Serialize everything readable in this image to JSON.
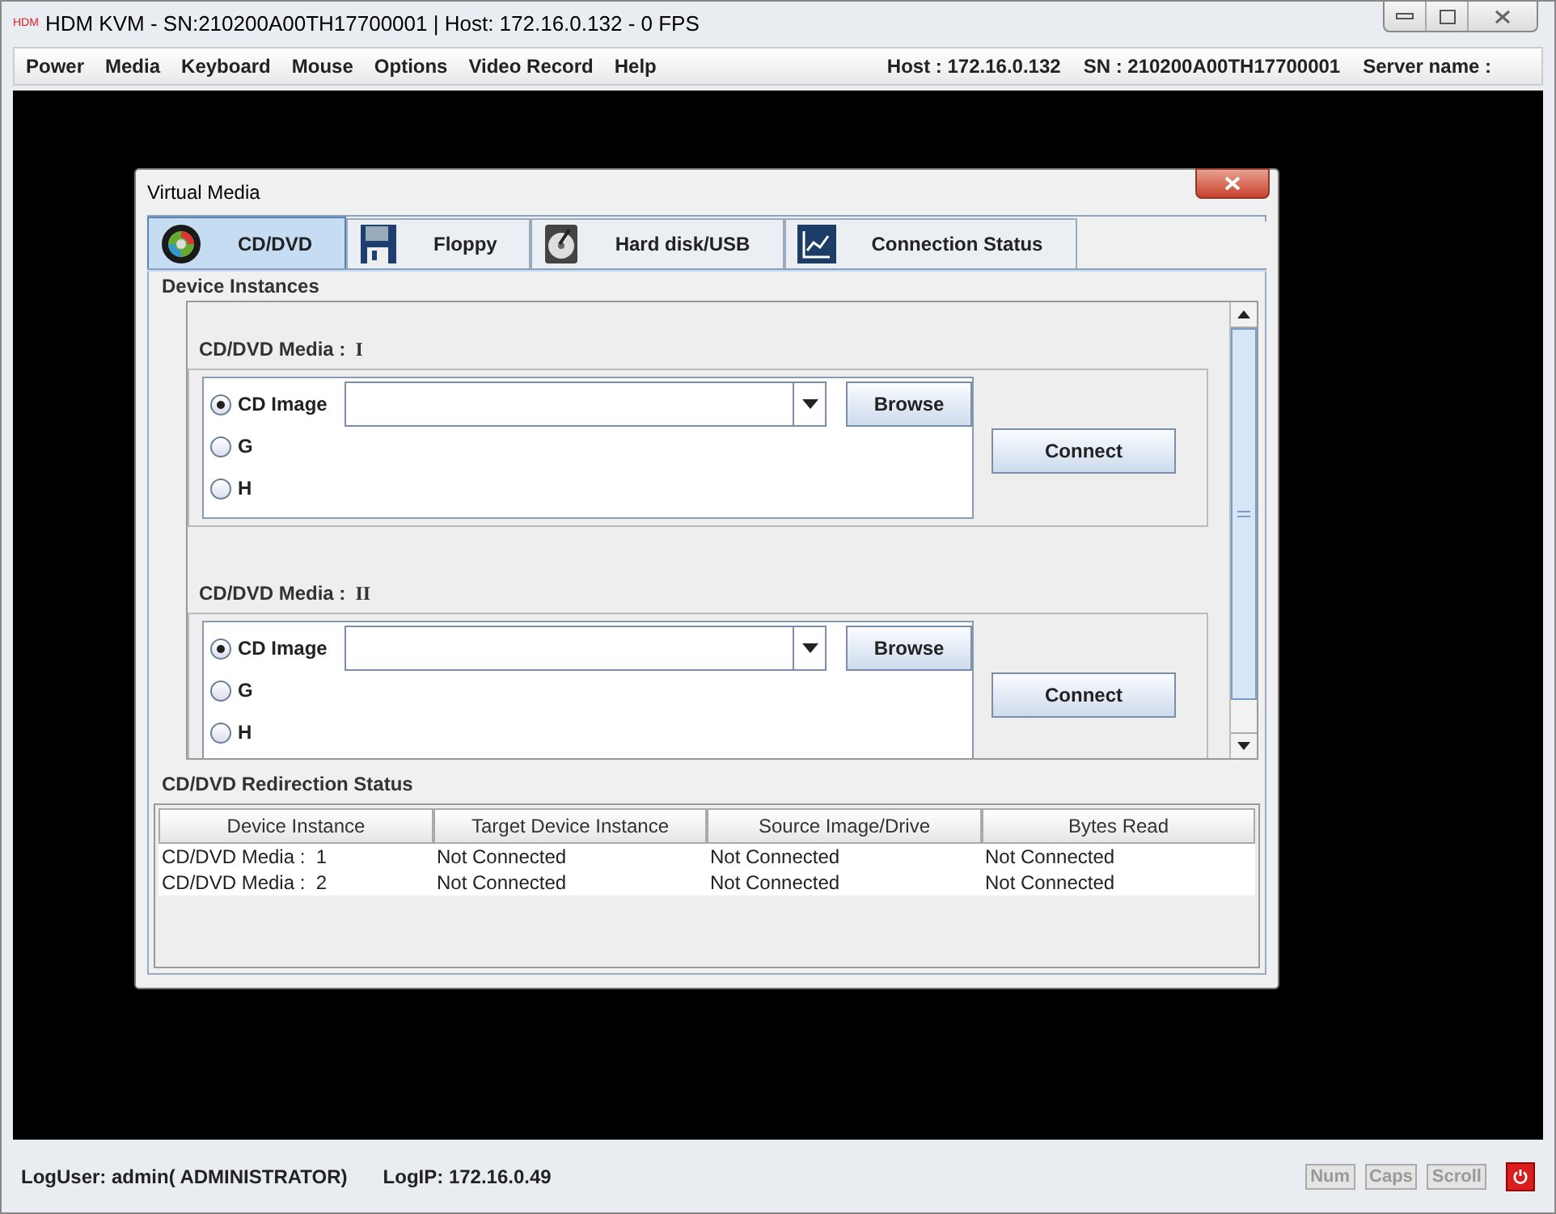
{
  "window": {
    "title": "HDM KVM - SN:210200A00TH17700001 | Host: 172.16.0.132 - 0 FPS",
    "logo": "HDM"
  },
  "menu": [
    "Power",
    "Media",
    "Keyboard",
    "Mouse",
    "Options",
    "Video Record",
    "Help"
  ],
  "menu_info": [
    "Host : 172.16.0.132",
    "SN : 210200A00TH17700001",
    "Server name :"
  ],
  "dialog": {
    "title": "Virtual Media",
    "tabs": [
      {
        "label": "CD/DVD",
        "kind": "disc",
        "selected": true
      },
      {
        "label": "Floppy",
        "kind": "floppy",
        "selected": false
      },
      {
        "label": "Hard disk/USB",
        "kind": "harddisk",
        "selected": false
      },
      {
        "label": "Connection Status",
        "kind": "chart",
        "selected": false
      }
    ],
    "section_title": "Device Instances",
    "media": [
      {
        "label": "CD/DVD Media :",
        "numeral": "I",
        "options": [
          {
            "label": "CD Image",
            "selected": true
          },
          {
            "label": "G",
            "selected": false
          },
          {
            "label": "H",
            "selected": false
          }
        ],
        "browse": "Browse",
        "connect": "Connect"
      },
      {
        "label": "CD/DVD Media :",
        "numeral": "II",
        "options": [
          {
            "label": "CD Image",
            "selected": true
          },
          {
            "label": "G",
            "selected": false
          },
          {
            "label": "H",
            "selected": false
          }
        ],
        "browse": "Browse",
        "connect": "Connect"
      }
    ],
    "status_title": "CD/DVD Redirection Status",
    "table": {
      "columns": [
        "Device Instance",
        "Target Device Instance",
        "Source Image/Drive",
        "Bytes Read"
      ],
      "rows": [
        [
          "CD/DVD Media :  1",
          "Not Connected",
          "Not Connected",
          "Not Connected"
        ],
        [
          "CD/DVD Media :  2",
          "Not Connected",
          "Not Connected",
          "Not Connected"
        ]
      ]
    }
  },
  "status_bar": {
    "user": "LogUser: admin( ADMINISTRATOR)",
    "ip": "LogIP: 172.16.0.49",
    "locks": [
      {
        "label": "Num",
        "on": false
      },
      {
        "label": "Caps",
        "on": false
      },
      {
        "label": "Scroll",
        "on": false
      }
    ]
  }
}
